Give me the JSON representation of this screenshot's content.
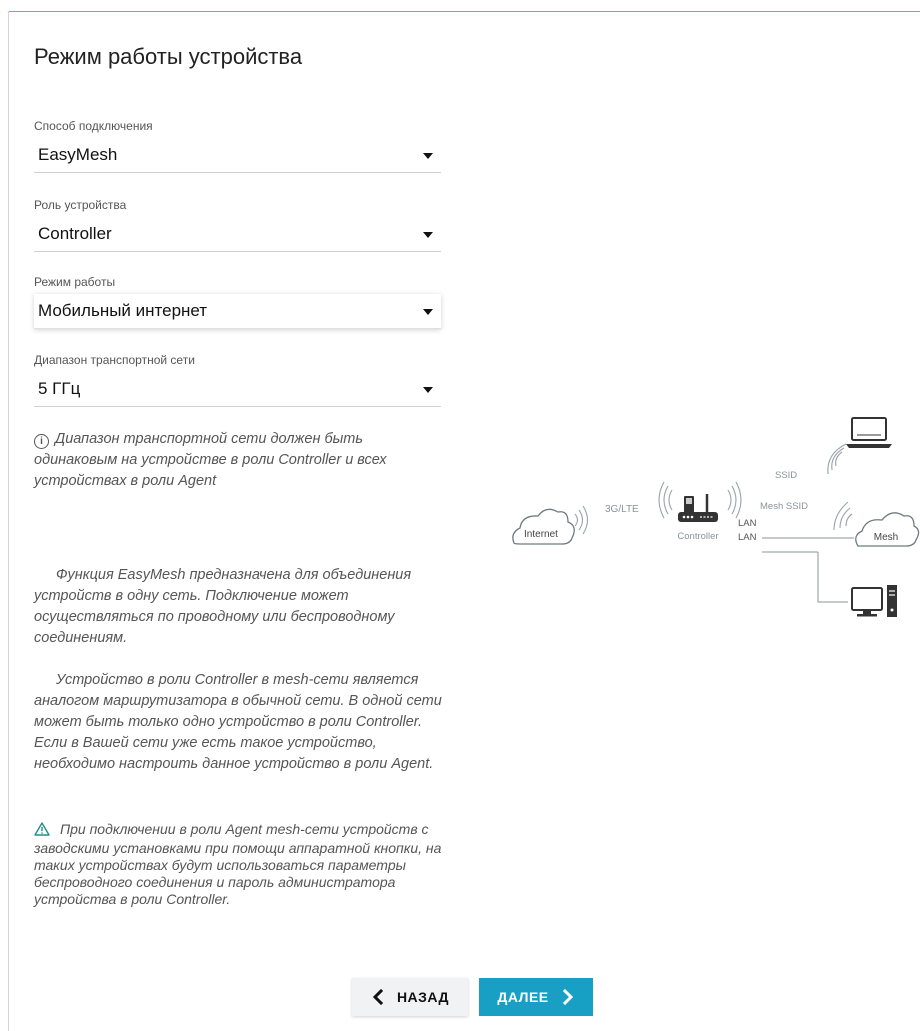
{
  "page": {
    "title": "Режим работы устройства"
  },
  "fields": {
    "connection": {
      "label": "Способ подключения",
      "value": "EasyMesh"
    },
    "role": {
      "label": "Роль устройства",
      "value": "Controller"
    },
    "mode": {
      "label": "Режим работы",
      "value": "Мобильный интернет"
    },
    "band": {
      "label": "Диапазон транспортной сети",
      "value": "5 ГГц"
    }
  },
  "info_note": "Диапазон транспортной сети должен быть одинаковым на устройстве в роли Controller и всех устройствах в роли Agent",
  "description": {
    "para1": "Функция EasyMesh предназначена для объединения устройств в одну сеть. Подключение может осуществляться по проводному или беспроводному соединениям.",
    "para2": "Устройство в роли Controller в mesh-сети является аналогом маршрутизатора в обычной сети. В одной сети может быть только одно устройство в роли Controller. Если в Вашей сети уже есть такое устройство, необходимо настроить данное устройство в роли Agent."
  },
  "warning": "При подключении в роли Agent mesh-сети устройств с заводскими установками при помощи аппаратной кнопки, на таких устройствах будут использоваться параметры беспроводного соединения и пароль администратора устройства в роли Controller.",
  "diagram": {
    "internet": "Internet",
    "uplink": "3G/LTE",
    "controller": "Controller",
    "ssid": "SSID",
    "mesh_ssid": "Mesh SSID",
    "lan1": "LAN",
    "lan2": "LAN",
    "mesh": "Mesh"
  },
  "buttons": {
    "back": "НАЗАД",
    "next": "ДАЛЕЕ"
  },
  "colors": {
    "accent": "#18a0c4",
    "diagram_gray": "#8a9499",
    "text_muted": "#555555"
  }
}
